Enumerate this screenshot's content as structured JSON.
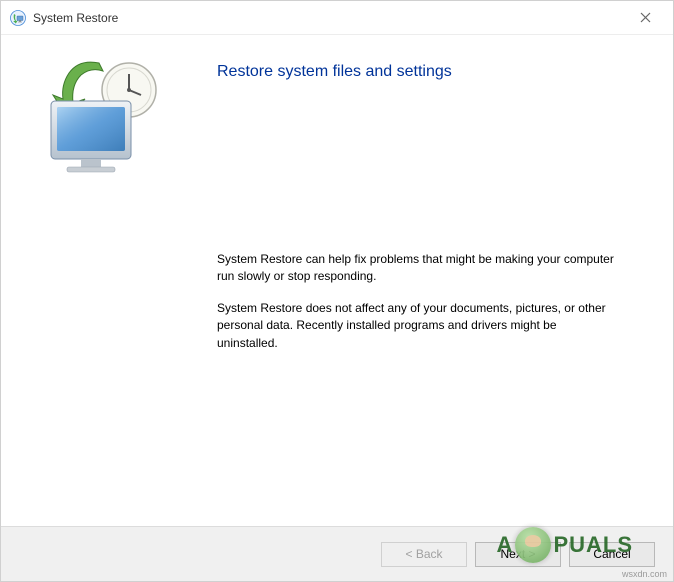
{
  "titlebar": {
    "title": "System Restore"
  },
  "main": {
    "heading": "Restore system files and settings",
    "paragraph1": "System Restore can help fix problems that might be making your computer run slowly or stop responding.",
    "paragraph2": "System Restore does not affect any of your documents, pictures, or other personal data. Recently installed programs and drivers might be uninstalled."
  },
  "buttons": {
    "back": "< Back",
    "next": "Next >",
    "cancel": "Cancel"
  },
  "watermark": {
    "prefix": "A",
    "suffix": "PUALS",
    "source": "wsxdn.com"
  }
}
